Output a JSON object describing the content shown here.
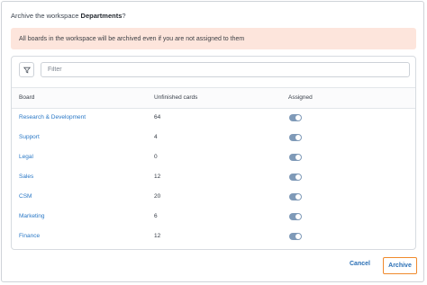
{
  "dialog": {
    "title_prefix": "Archive the workspace ",
    "workspace_name": "Departments",
    "title_suffix": "?"
  },
  "warning": {
    "text": "All boards in the workspace will be archived even if you are not assigned to them",
    "color": "#fde5dc"
  },
  "filter": {
    "icon": "filter-icon",
    "placeholder": "Filter",
    "value": ""
  },
  "table": {
    "headers": {
      "board": "Board",
      "unfinished_cards": "Unfinished cards",
      "assigned": "Assigned"
    },
    "rows": [
      {
        "board": "Research & Development",
        "cards": "64",
        "assigned": true
      },
      {
        "board": "Support",
        "cards": "4",
        "assigned": true
      },
      {
        "board": "Legal",
        "cards": "0",
        "assigned": true
      },
      {
        "board": "Sales",
        "cards": "12",
        "assigned": true
      },
      {
        "board": "CSM",
        "cards": "20",
        "assigned": true
      },
      {
        "board": "Marketing",
        "cards": "6",
        "assigned": true
      },
      {
        "board": "Finance",
        "cards": "12",
        "assigned": true
      }
    ]
  },
  "actions": {
    "cancel_label": "Cancel",
    "archive_label": "Archive",
    "link_color": "#2a6fb5",
    "highlight_color": "#f08a2c"
  }
}
